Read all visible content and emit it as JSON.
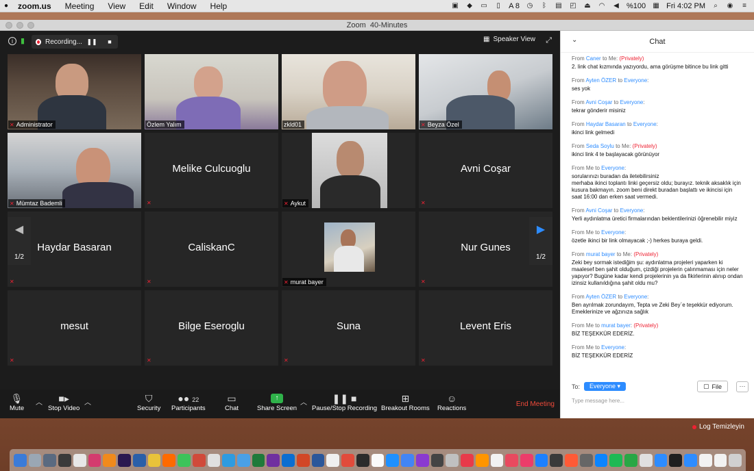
{
  "menubar": {
    "app": "zoom.us",
    "menus": [
      "Meeting",
      "View",
      "Edit",
      "Window",
      "Help"
    ],
    "status_a8": "8",
    "battery": "%100",
    "clock": "Fri 4:02 PM"
  },
  "window": {
    "title": "Zoom  40-Minutes"
  },
  "topbar": {
    "recording_label": "Recording...",
    "speaker_view_label": "Speaker View"
  },
  "participants": [
    {
      "name": "Administrator",
      "mode": "video"
    },
    {
      "name": "Özlem Yalım",
      "mode": "video"
    },
    {
      "name": "zkld01",
      "mode": "video",
      "active": true
    },
    {
      "name": "Beyza Özel",
      "mode": "video"
    },
    {
      "name": "Mümtaz Bademli",
      "mode": "video"
    },
    {
      "name": "Melike Culcuoglu",
      "mode": "name"
    },
    {
      "name": "Aykut",
      "mode": "video"
    },
    {
      "name": "Avni Coşar",
      "mode": "name"
    },
    {
      "name": "Haydar Basaran",
      "mode": "name"
    },
    {
      "name": "CaliskanC",
      "mode": "name"
    },
    {
      "name": "murat bayer",
      "mode": "photo"
    },
    {
      "name": "Nur Gunes",
      "mode": "name"
    },
    {
      "name": "mesut",
      "mode": "name"
    },
    {
      "name": "Bilge Eseroglu",
      "mode": "name"
    },
    {
      "name": "Suna",
      "mode": "name"
    },
    {
      "name": "Levent Eris",
      "mode": "name"
    }
  ],
  "pager": {
    "left": "1/2",
    "right": "1/2"
  },
  "toolbar": {
    "mute": "Mute",
    "stop_video": "Stop Video",
    "security": "Security",
    "participants": "Participants",
    "participants_count": "22",
    "chat": "Chat",
    "share_screen": "Share Screen",
    "pause_stop_recording": "Pause/Stop Recording",
    "breakout_rooms": "Breakout Rooms",
    "reactions": "Reactions",
    "end_meeting": "End Meeting"
  },
  "chat": {
    "title": "Chat",
    "messages": [
      {
        "from": "Caner",
        "to": "Me",
        "private": true,
        "text": "2. link chat kızmında yazıyordu, ama görüşme bitince bu link gitti"
      },
      {
        "from": "Ayten ÖZER",
        "to": "Everyone",
        "private": false,
        "text": "ses yok"
      },
      {
        "from": "Avni Coşar",
        "to": "Everyone",
        "private": false,
        "text": "tekrar gönderir misiniz"
      },
      {
        "from": "Haydar Basaran",
        "to": "Everyone",
        "private": false,
        "text": "ikinci link gelmedi"
      },
      {
        "from": "Seda Soylu",
        "to": "Me",
        "private": true,
        "text": "ikinci link 4 te başlayacak görünüyor"
      },
      {
        "from": "Me",
        "to": "Everyone",
        "private": false,
        "text": "sorularınızı buradan da iletebilirsiniz\nmerhaba ikinci toplantı  linki geçersiz oldu; burayız. teknik aksaklık için kusura bakmayın. zoom beni direkt buradan başlattı ve  ikincisi için saat 16:00 dan erken saat vermedi."
      },
      {
        "from": "Avni Coşar",
        "to": "Everyone",
        "private": false,
        "text": "Yerli aydınlatma üretici firmalarından beklentilerinizi öğrenebilir miyiz"
      },
      {
        "from": "Me",
        "to": "Everyone",
        "private": false,
        "text": "özetle ikinci bir link olmayacak ;-) herkes buraya geldi."
      },
      {
        "from": "murat bayer",
        "to": "Me",
        "private": true,
        "text": "Zeki bey sormak istediğim şu: aydınlatma projeleri yaparken ki maalesef ben şahit olduğum, çizdiği projelerin çalınmaması için neler yapıyor? Bugüne kadar kendi projelerinin ya da fikirlerinin alınıp ondan izinsiz kullanıldığına şahit oldu mu?"
      },
      {
        "from": "Ayten ÖZER",
        "to": "Everyone",
        "private": false,
        "text": "Ben ayrılmak zorundayım, Tepta ve Zeki Bey`e teşekkür ediyorum. Emeklerinize ve ağzınıza sağlık"
      },
      {
        "from": "Me",
        "to": "murat bayer",
        "private": true,
        "text": "BİZ TEŞEKKÜR EDERİZ."
      },
      {
        "from": "Me",
        "to": "Everyone",
        "private": false,
        "text": "BİZ TEŞEKKÜR EDERİZ"
      }
    ],
    "from_prefix": "From",
    "to_word": "to",
    "me_word": "Me",
    "privately_label": "(Privately)",
    "to_label": "To:",
    "recipient": "Everyone",
    "file_label": "File",
    "input_placeholder": "Type message here..."
  },
  "desktop": {
    "log_label": "Log Temizleyin"
  },
  "dock_colors": [
    "#3b7bd8",
    "#9aa7b4",
    "#5a6a80",
    "#3a3a3a",
    "#e7e7e7",
    "#d43b6e",
    "#f08a1c",
    "#2a1850",
    "#2b5fa8",
    "#e9c33a",
    "#ff6a00",
    "#3dc35a",
    "#d04a3a",
    "#e0e0e0",
    "#2e9be0",
    "#4aa0e6",
    "#1f7a3a",
    "#7030a0",
    "#0a6ed1",
    "#d24726",
    "#2b579a",
    "#f0f0f0",
    "#e14b3b",
    "#2b2b2b",
    "#fafafa",
    "#1e90ff",
    "#4285f4",
    "#8a3ad0",
    "#444",
    "#c0c0c0",
    "#e83a4a",
    "#ff9500",
    "#f2f2f2",
    "#e84a5f",
    "#ec3d6a",
    "#1d80ff",
    "#3a3a3a",
    "#ff5a36",
    "#666",
    "#0a84ff",
    "#1db954",
    "#28a745",
    "#e0e0e0",
    "#2d8cff",
    "#1f1f1f",
    "#2d8cff",
    "#f2f2f2",
    "#f2f2f2",
    "#d0d0d0"
  ]
}
